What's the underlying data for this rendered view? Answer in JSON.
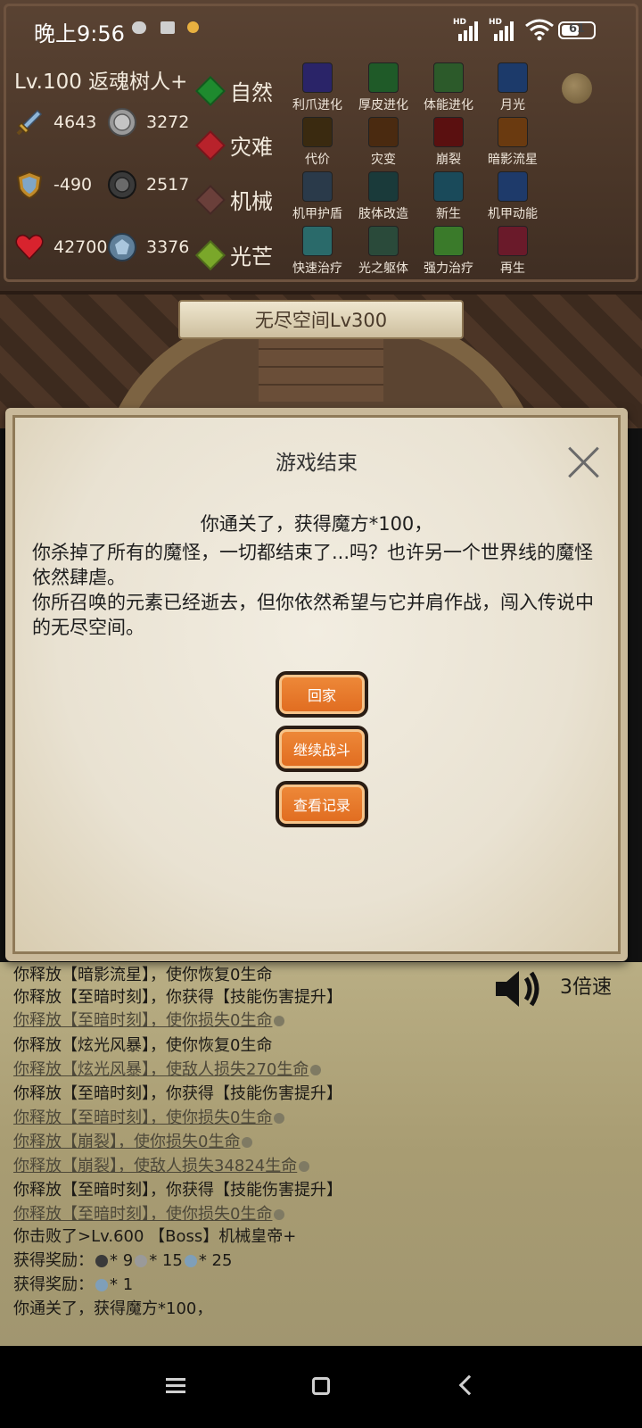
{
  "status_bar": {
    "time": "晚上9:56",
    "network_1": "HD",
    "network_2": "HD",
    "battery": "61",
    "battery_level": 0.61
  },
  "hero": {
    "title": "Lv.100  返魂树人+",
    "stats": [
      {
        "icon": "sword-icon",
        "value": "4643"
      },
      {
        "icon": "silver-coin-icon",
        "value": "3272"
      },
      {
        "icon": "shield-icon",
        "value": "-490"
      },
      {
        "icon": "dark-coin-icon",
        "value": "2517"
      },
      {
        "icon": "heart-icon",
        "value": "42700"
      },
      {
        "icon": "crystal-icon",
        "value": "3376"
      }
    ]
  },
  "elements": [
    {
      "label": "自然",
      "color": "#1e8a2e"
    },
    {
      "label": "灾难",
      "color": "#b8222b"
    },
    {
      "label": "机械",
      "color": "#6a3f3a"
    },
    {
      "label": "光芒",
      "color": "#7aa72a"
    }
  ],
  "skills": [
    {
      "label": "利爪进化",
      "color": "#2a2468"
    },
    {
      "label": "厚皮进化",
      "color": "#1f5a28"
    },
    {
      "label": "体能进化",
      "color": "#2c5a2a"
    },
    {
      "label": "月光",
      "color": "#1c3a6a"
    },
    {
      "label": "代价",
      "color": "#3a2a10"
    },
    {
      "label": "灾变",
      "color": "#4a2a10"
    },
    {
      "label": "崩裂",
      "color": "#5a1010"
    },
    {
      "label": "暗影流星",
      "color": "#6a3a10"
    },
    {
      "label": "机甲护盾",
      "color": "#2a3a4a"
    },
    {
      "label": "肢体改造",
      "color": "#1a3a3a"
    },
    {
      "label": "新生",
      "color": "#1a4a5a"
    },
    {
      "label": "机甲动能",
      "color": "#1e3a6a"
    },
    {
      "label": "快速治疗",
      "color": "#2a6a6a"
    },
    {
      "label": "光之躯体",
      "color": "#2a4a3a"
    },
    {
      "label": "强力治疗",
      "color": "#3a7a2a"
    },
    {
      "label": "再生",
      "color": "#6a1a2a"
    }
  ],
  "arena": {
    "level_title": "无尽空间Lv300"
  },
  "modal": {
    "title": "游戏结束",
    "summary": "你通关了，获得魔方*100，",
    "body_1": "你杀掉了所有的魔怪，一切都结束了...吗？也许另一个世界线的魔怪依然肆虐。",
    "body_2": "你所召唤的元素已经逝去，但你依然希望与它并肩作战，闯入传说中的无尽空间。",
    "buttons": {
      "home": "回家",
      "continue": "继续战斗",
      "records": "查看记录"
    }
  },
  "log": {
    "speed": "3倍速",
    "lines": [
      "你释放【暗影流星】，使你恢复0生命",
      "你释放【至暗时刻】，你获得【技能伤害提升】",
      "你释放【至暗时刻】，使你损失0生命",
      "你释放【炫光风暴】，使你恢复0生命",
      "你释放【炫光风暴】，使敌人损失270生命",
      "你释放【至暗时刻】，你获得【技能伤害提升】",
      "你释放【至暗时刻】，使你损失0生命",
      "你释放【崩裂】，使你损失0生命",
      "你释放【崩裂】，使敌人损失34824生命",
      "你释放【至暗时刻】，你获得【技能伤害提升】",
      "你释放【至暗时刻】，使你损失0生命",
      "你击败了>Lv.600 【Boss】机械皇帝+"
    ],
    "reward_label": "获得奖励：",
    "reward_1": [
      "* 9",
      "* 15",
      "* 25"
    ],
    "reward_2": "* 1",
    "final_line": "你通关了，获得魔方*100，"
  }
}
